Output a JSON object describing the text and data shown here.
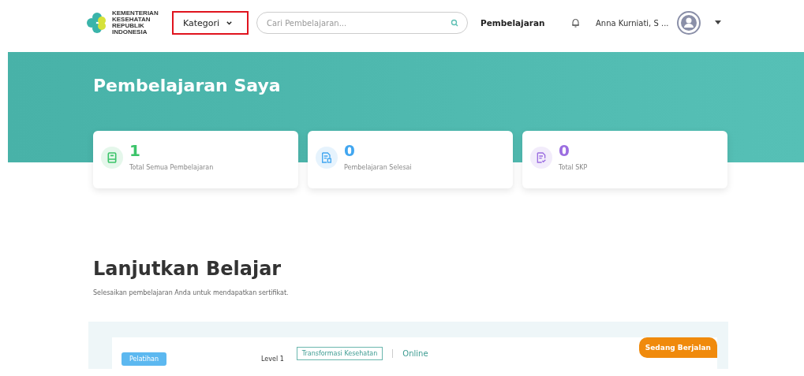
{
  "header": {
    "logo_lines": [
      "KEMENTERIAN",
      "KESEHATAN",
      "REPUBLIK",
      "INDONESIA"
    ],
    "category_button": "Kategori",
    "search": {
      "placeholder": "Cari Pembelajaran..."
    },
    "nav_link": "Pembelajaran",
    "user_name": "Anna Kurniati, S ..."
  },
  "banner": {
    "title": "Pembelajaran Saya"
  },
  "stats": [
    {
      "kind": "book",
      "value": "1",
      "label": "Total Semua Pembelajaran",
      "color": "#3cc46a"
    },
    {
      "kind": "document",
      "value": "0",
      "label": "Pembelajaran Selesai",
      "color": "#41a6f0"
    },
    {
      "kind": "certificate",
      "value": "0",
      "label": "Total SKP",
      "color": "#9b6de0"
    }
  ],
  "continue": {
    "title": "Lanjutkan Belajar",
    "subtitle": "Selesaikan pembelajaran Anda untuk mendapatkan sertifikat."
  },
  "course": {
    "type_badge": "Pelatihan",
    "level": "Level 1",
    "topic": "Transformasi Kesehatan",
    "mode": "Online",
    "status": "Sedang Berjalan"
  }
}
